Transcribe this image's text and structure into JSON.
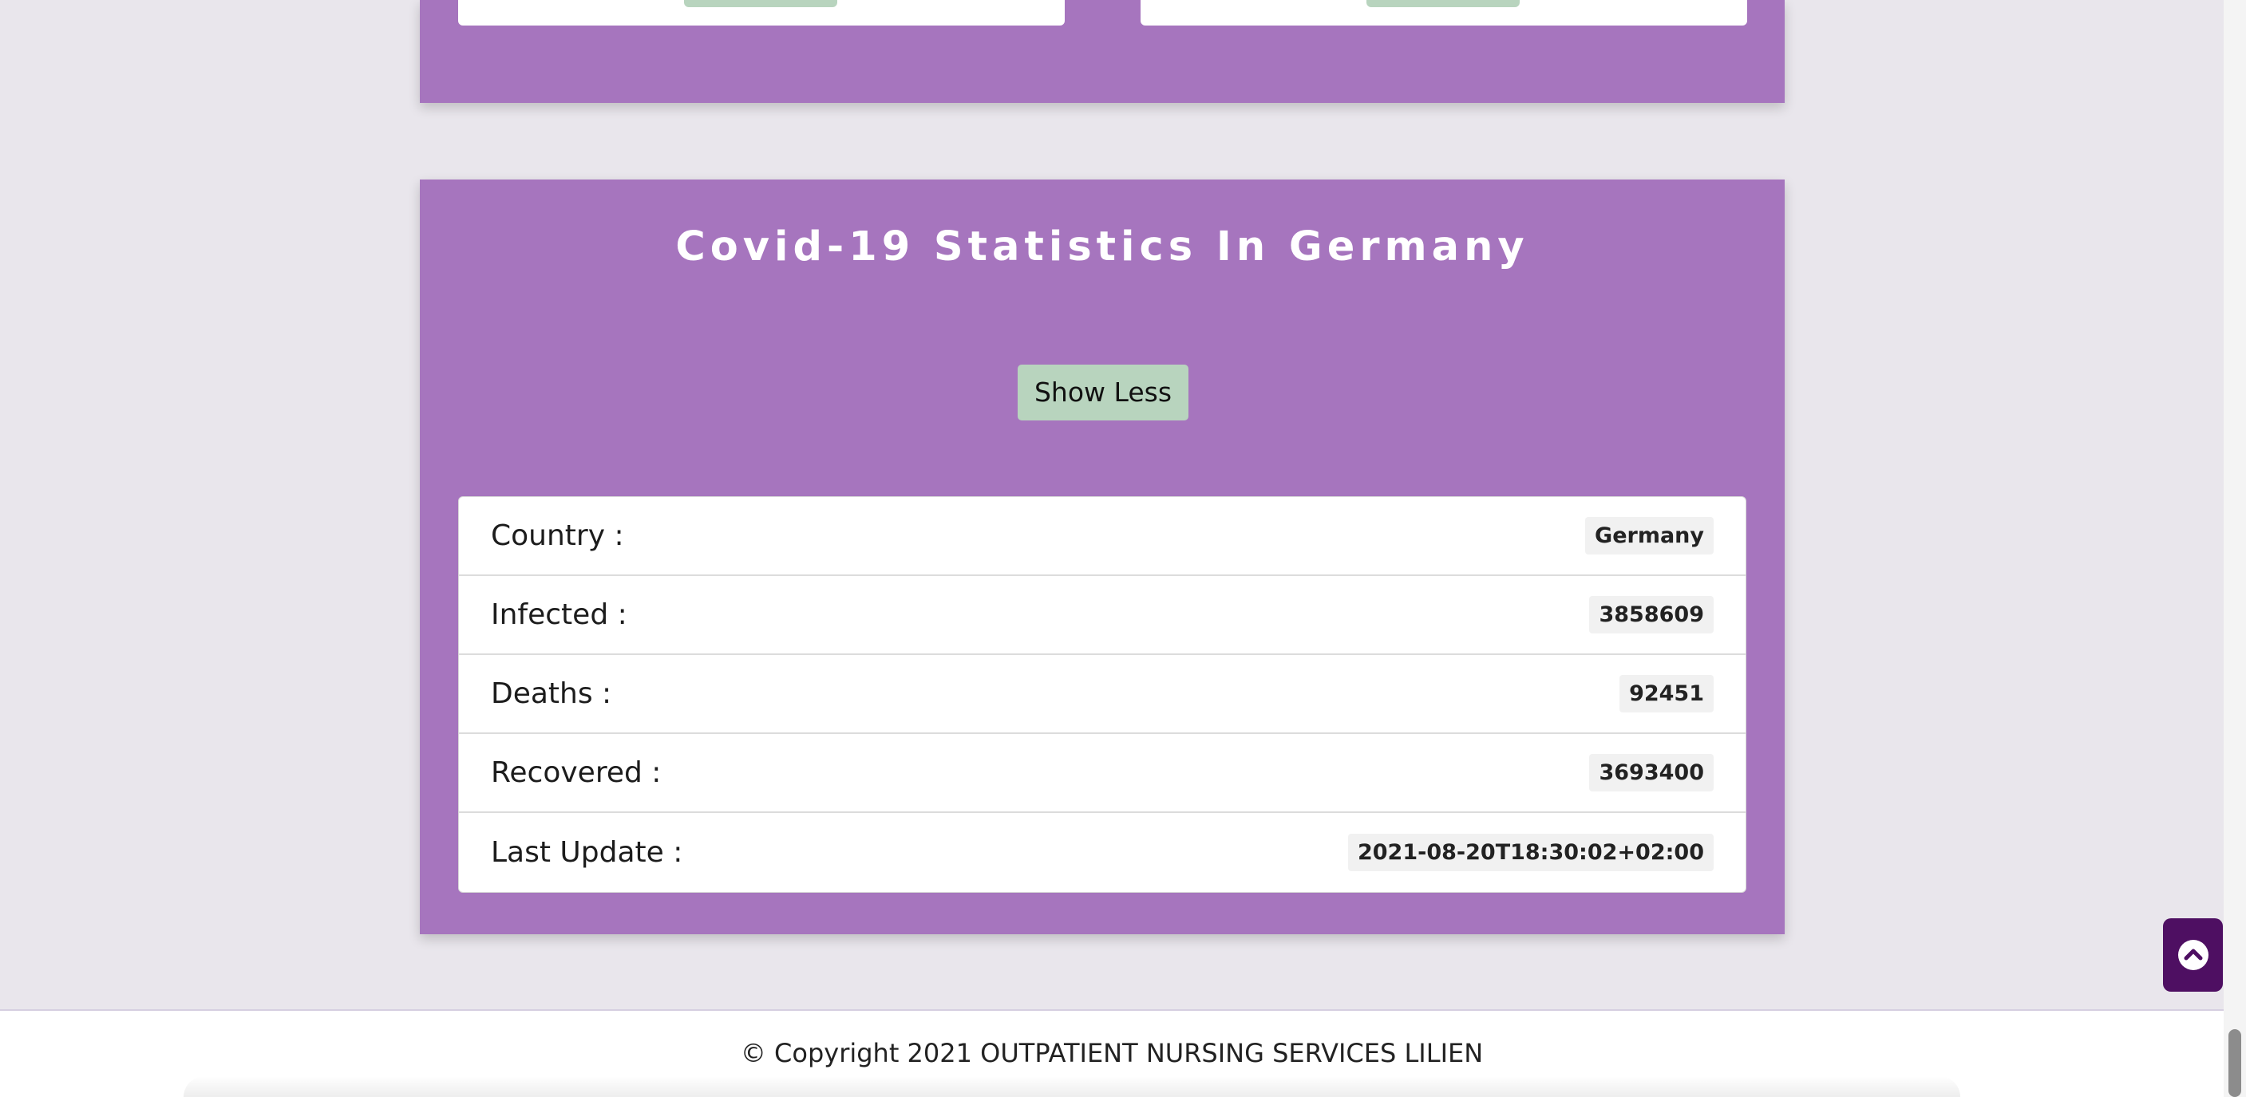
{
  "stats": {
    "title": "Covid-19 Statistics In Germany",
    "toggle_label": "Show Less",
    "rows": [
      {
        "label": "Country :",
        "value": "Germany"
      },
      {
        "label": "Infected :",
        "value": "3858609"
      },
      {
        "label": "Deaths :",
        "value": "92451"
      },
      {
        "label": "Recovered :",
        "value": "3693400"
      },
      {
        "label": "Last Update :",
        "value": "2021-08-20T18:30:02+02:00"
      }
    ]
  },
  "footer": {
    "copyright": "© Copyright 2021 OUTPATIENT NURSING SERVICES LILIEN"
  },
  "scroll_top": {
    "icon": "chevron-up-circle-icon"
  },
  "colors": {
    "page_background": "#e9e6ec",
    "section_background": "#a675be",
    "button_background": "#b8d4be",
    "scroll_top_background": "#4e0f62"
  }
}
